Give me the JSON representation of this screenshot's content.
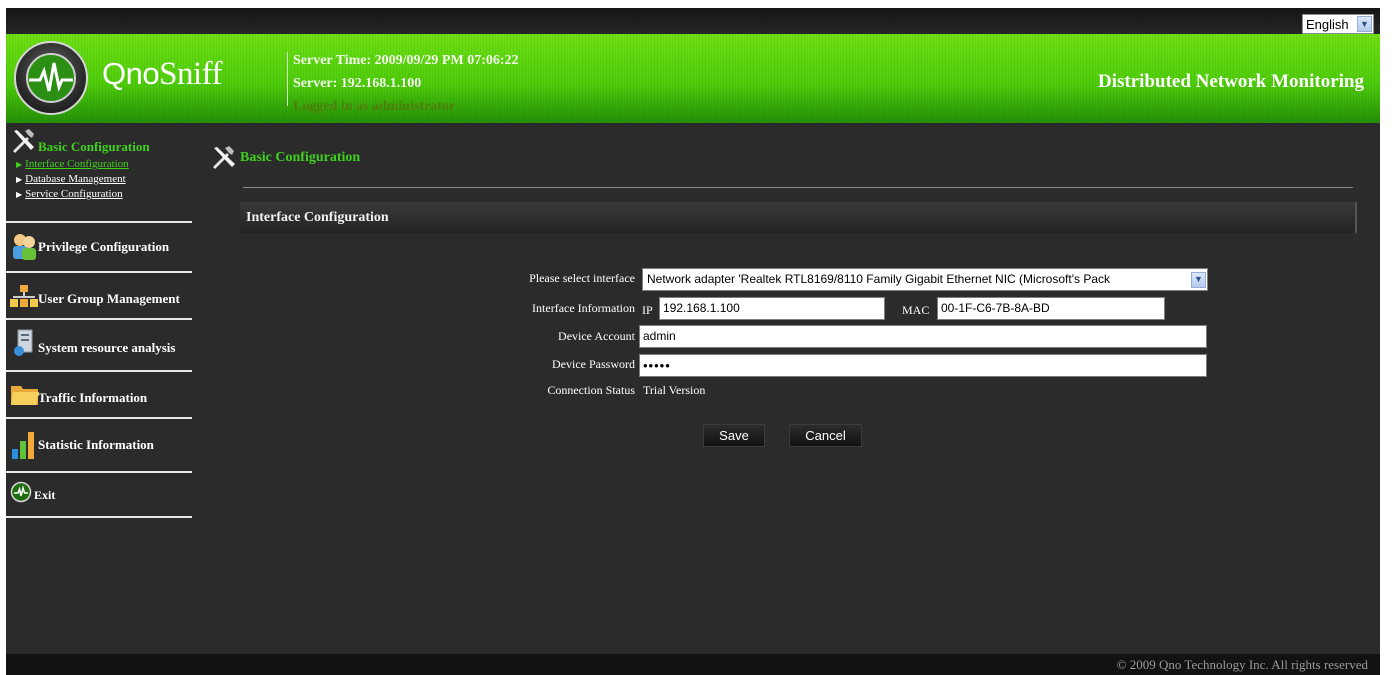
{
  "language": {
    "selected": "English"
  },
  "header": {
    "brand_part1": "Qno",
    "brand_part2": "Sniff",
    "server_time": "Server Time: 2009/09/29 PM 07:06:22",
    "server": "Server: 192.168.1.100",
    "logged_in": "Logged in as administrator",
    "tagline": "Distributed Network Monitoring"
  },
  "sidebar": {
    "basic": {
      "title": "Basic Configuration",
      "items": [
        "Interface Configuration",
        "Database Management",
        "Service Configuration"
      ]
    },
    "sections": [
      "Privilege Configuration",
      "User Group Management",
      "System resource analysis",
      "Traffic Information",
      "Statistic Information",
      "Exit"
    ]
  },
  "main": {
    "title": "Basic Configuration",
    "panel_title": "Interface Configuration"
  },
  "form": {
    "select_label": "Please select interface",
    "select_value": "Network adapter 'Realtek RTL8169/8110 Family Gigabit Ethernet NIC (Microsoft's Pack",
    "info_label": "Interface Information",
    "ip_label": "IP",
    "ip_value": "192.168.1.100",
    "mac_label": "MAC",
    "mac_value": "00-1F-C6-7B-8A-BD",
    "account_label": "Device Account",
    "account_value": "admin",
    "password_label": "Device Password",
    "password_value": "•••••",
    "status_label": "Connection Status",
    "status_value": "Trial Version",
    "save": "Save",
    "cancel": "Cancel"
  },
  "footer": {
    "copyright": "© 2009 Qno Technology Inc. All rights reserved"
  }
}
